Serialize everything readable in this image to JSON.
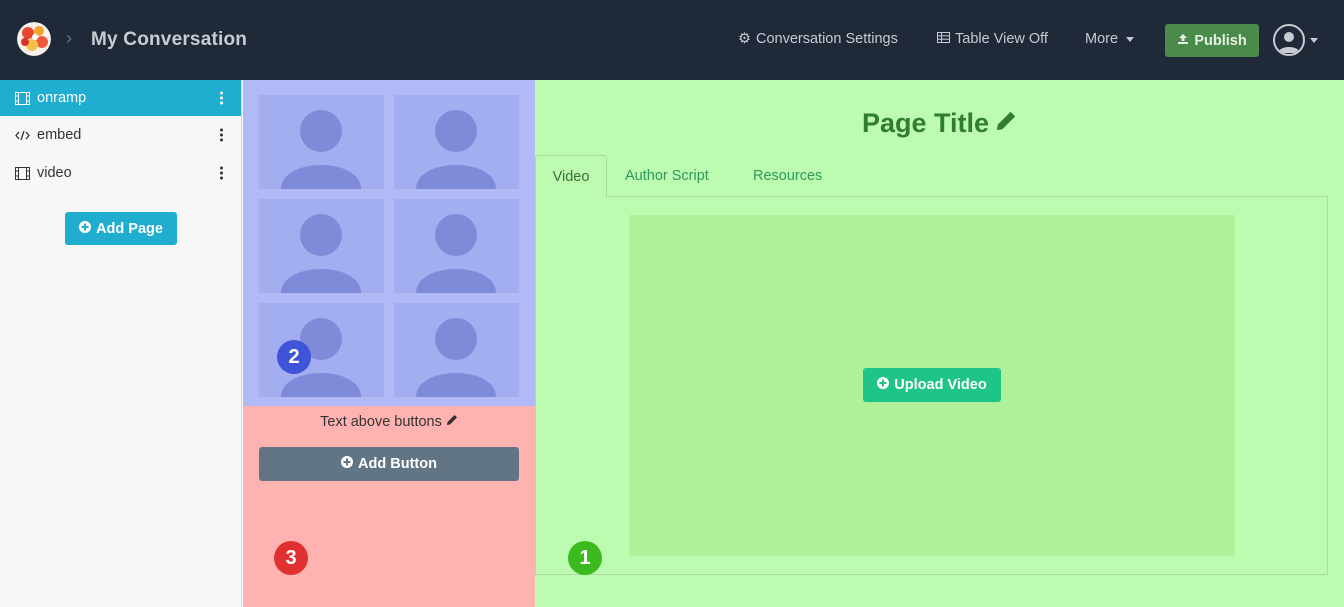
{
  "header": {
    "title": "My Conversation",
    "settings_label": "Conversation Settings",
    "table_view_label": "Table View Off",
    "more_label": "More",
    "publish_label": "Publish"
  },
  "sidebar": {
    "pages": [
      {
        "label": "onramp",
        "icon": "film-icon",
        "active": true
      },
      {
        "label": "embed",
        "icon": "code-icon",
        "active": false
      },
      {
        "label": "video",
        "icon": "film-icon",
        "active": false
      }
    ],
    "add_page_label": "Add Page"
  },
  "collage": {
    "tile_count": 6
  },
  "buttons_area": {
    "text_above": "Text above buttons",
    "add_button_label": "Add Button"
  },
  "main": {
    "page_title": "Page Title",
    "tabs": [
      {
        "label": "Video",
        "active": true
      },
      {
        "label": "Author Script",
        "active": false
      },
      {
        "label": "Resources",
        "active": false
      }
    ],
    "upload_label": "Upload Video"
  },
  "markers": {
    "zone1": "1",
    "zone2": "2",
    "zone3": "3"
  },
  "colors": {
    "navbar": "#1f2937",
    "sidebar_active": "#1fadd0",
    "publish": "#4a8a4a",
    "zone_blue": "#b1baf6",
    "zone_red": "#ffb3b0",
    "zone_green": "#bcfbb0",
    "upload": "#1fc487"
  }
}
